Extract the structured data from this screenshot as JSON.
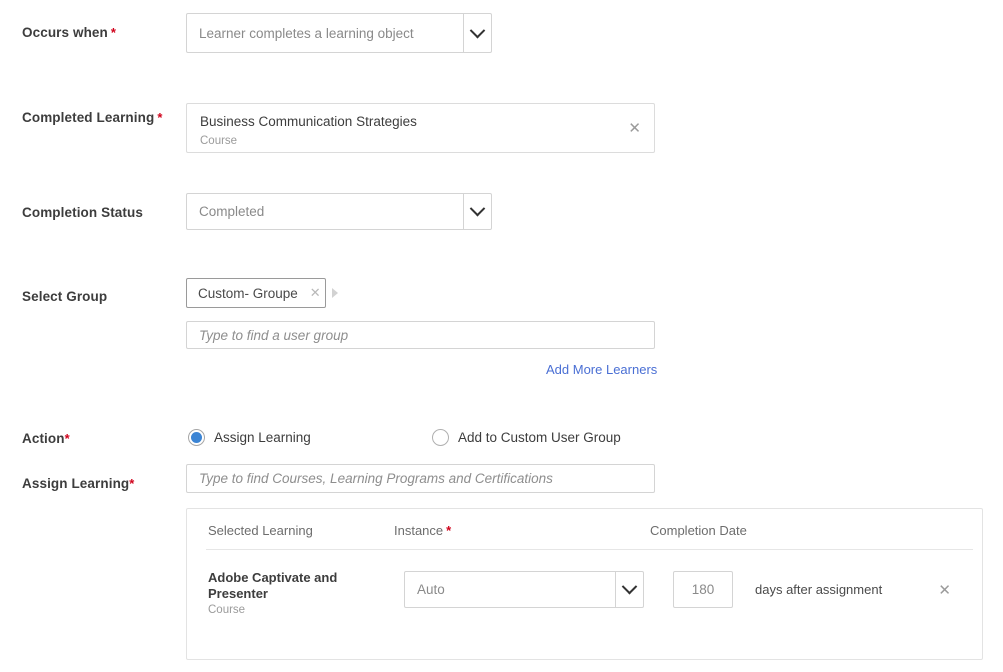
{
  "form": {
    "occurs_when": {
      "label": "Occurs when",
      "required": true,
      "value": "Learner completes a learning object"
    },
    "completed_learning": {
      "label": "Completed Learning",
      "required": true,
      "item_title": "Business Communication Strategies",
      "item_type": "Course",
      "remove_icon": "close-icon"
    },
    "completion_status": {
      "label": "Completion Status",
      "required": false,
      "value": "Completed"
    },
    "select_group": {
      "label": "Select Group",
      "required": false,
      "chip_label": "Custom- Groupe",
      "chip_remove_icon": "close-icon",
      "search_placeholder": "Type to find a user group",
      "add_more_link": "Add More Learners"
    },
    "action": {
      "label": "Action",
      "required": true,
      "options": [
        {
          "label": "Assign Learning",
          "selected": true
        },
        {
          "label": "Add to Custom User Group",
          "selected": false
        }
      ]
    },
    "assign_learning": {
      "label": "Assign Learning",
      "required": true,
      "search_placeholder": "Type to find Courses, Learning Programs and Certifications"
    }
  },
  "selected_learning_table": {
    "columns": [
      {
        "label": "Selected Learning",
        "required": false
      },
      {
        "label": "Instance",
        "required": true
      },
      {
        "label": "Completion Date",
        "required": false
      }
    ],
    "rows": [
      {
        "title": "Adobe Captivate and Presenter",
        "subtitle": "Course",
        "instance": "Auto",
        "days": "180",
        "days_suffix": "days after assignment",
        "remove_icon": "close-icon"
      }
    ]
  },
  "colors": {
    "required_asterisk": "#d0021b",
    "link": "#4a6fd4",
    "radio_selected": "#3b84d4",
    "border": "#d4d4d4",
    "label_text": "#3d3d3d",
    "placeholder_text": "#8e8e8e"
  }
}
